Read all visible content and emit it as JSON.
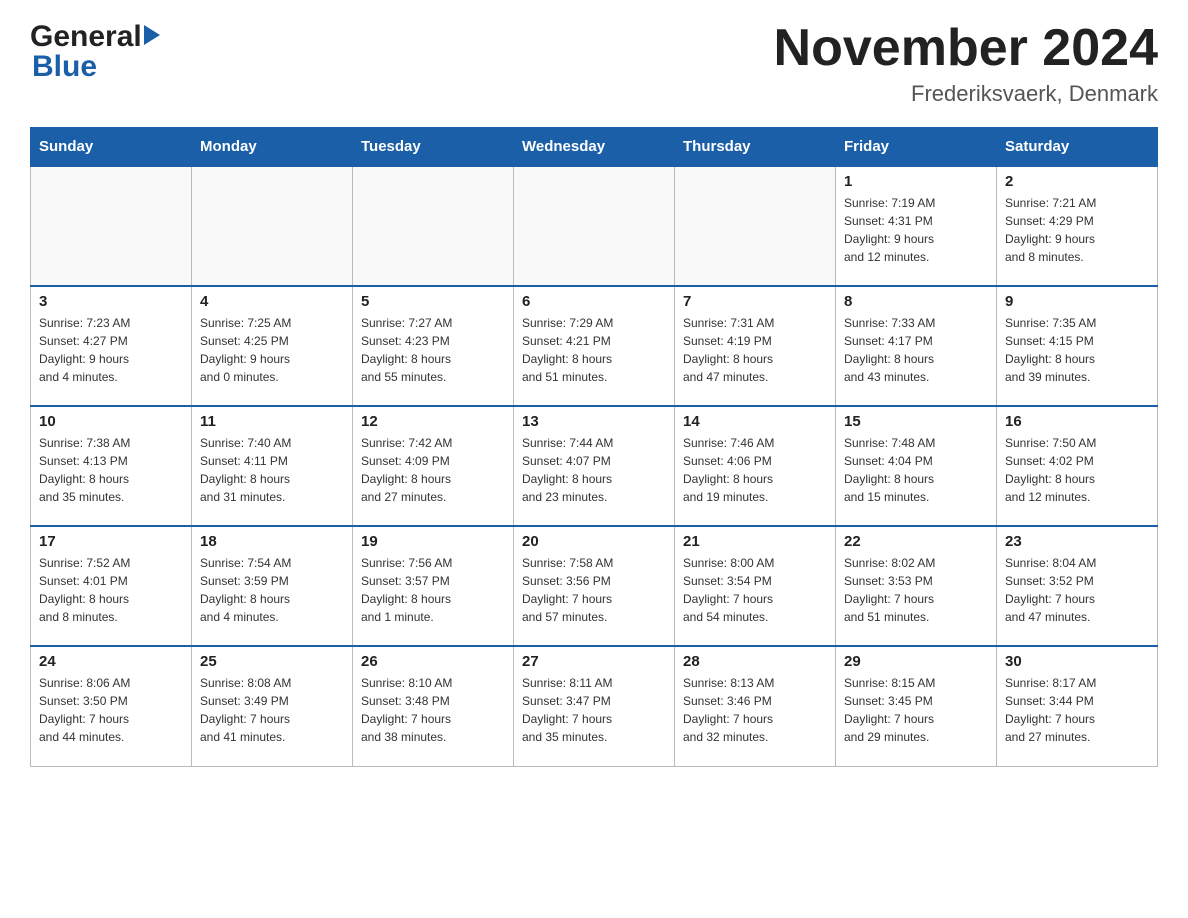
{
  "header": {
    "logo_general": "General",
    "logo_blue": "Blue",
    "month_title": "November 2024",
    "location": "Frederiksvaerk, Denmark"
  },
  "days_of_week": [
    "Sunday",
    "Monday",
    "Tuesday",
    "Wednesday",
    "Thursday",
    "Friday",
    "Saturday"
  ],
  "weeks": [
    [
      {
        "day": "",
        "info": ""
      },
      {
        "day": "",
        "info": ""
      },
      {
        "day": "",
        "info": ""
      },
      {
        "day": "",
        "info": ""
      },
      {
        "day": "",
        "info": ""
      },
      {
        "day": "1",
        "info": "Sunrise: 7:19 AM\nSunset: 4:31 PM\nDaylight: 9 hours\nand 12 minutes."
      },
      {
        "day": "2",
        "info": "Sunrise: 7:21 AM\nSunset: 4:29 PM\nDaylight: 9 hours\nand 8 minutes."
      }
    ],
    [
      {
        "day": "3",
        "info": "Sunrise: 7:23 AM\nSunset: 4:27 PM\nDaylight: 9 hours\nand 4 minutes."
      },
      {
        "day": "4",
        "info": "Sunrise: 7:25 AM\nSunset: 4:25 PM\nDaylight: 9 hours\nand 0 minutes."
      },
      {
        "day": "5",
        "info": "Sunrise: 7:27 AM\nSunset: 4:23 PM\nDaylight: 8 hours\nand 55 minutes."
      },
      {
        "day": "6",
        "info": "Sunrise: 7:29 AM\nSunset: 4:21 PM\nDaylight: 8 hours\nand 51 minutes."
      },
      {
        "day": "7",
        "info": "Sunrise: 7:31 AM\nSunset: 4:19 PM\nDaylight: 8 hours\nand 47 minutes."
      },
      {
        "day": "8",
        "info": "Sunrise: 7:33 AM\nSunset: 4:17 PM\nDaylight: 8 hours\nand 43 minutes."
      },
      {
        "day": "9",
        "info": "Sunrise: 7:35 AM\nSunset: 4:15 PM\nDaylight: 8 hours\nand 39 minutes."
      }
    ],
    [
      {
        "day": "10",
        "info": "Sunrise: 7:38 AM\nSunset: 4:13 PM\nDaylight: 8 hours\nand 35 minutes."
      },
      {
        "day": "11",
        "info": "Sunrise: 7:40 AM\nSunset: 4:11 PM\nDaylight: 8 hours\nand 31 minutes."
      },
      {
        "day": "12",
        "info": "Sunrise: 7:42 AM\nSunset: 4:09 PM\nDaylight: 8 hours\nand 27 minutes."
      },
      {
        "day": "13",
        "info": "Sunrise: 7:44 AM\nSunset: 4:07 PM\nDaylight: 8 hours\nand 23 minutes."
      },
      {
        "day": "14",
        "info": "Sunrise: 7:46 AM\nSunset: 4:06 PM\nDaylight: 8 hours\nand 19 minutes."
      },
      {
        "day": "15",
        "info": "Sunrise: 7:48 AM\nSunset: 4:04 PM\nDaylight: 8 hours\nand 15 minutes."
      },
      {
        "day": "16",
        "info": "Sunrise: 7:50 AM\nSunset: 4:02 PM\nDaylight: 8 hours\nand 12 minutes."
      }
    ],
    [
      {
        "day": "17",
        "info": "Sunrise: 7:52 AM\nSunset: 4:01 PM\nDaylight: 8 hours\nand 8 minutes."
      },
      {
        "day": "18",
        "info": "Sunrise: 7:54 AM\nSunset: 3:59 PM\nDaylight: 8 hours\nand 4 minutes."
      },
      {
        "day": "19",
        "info": "Sunrise: 7:56 AM\nSunset: 3:57 PM\nDaylight: 8 hours\nand 1 minute."
      },
      {
        "day": "20",
        "info": "Sunrise: 7:58 AM\nSunset: 3:56 PM\nDaylight: 7 hours\nand 57 minutes."
      },
      {
        "day": "21",
        "info": "Sunrise: 8:00 AM\nSunset: 3:54 PM\nDaylight: 7 hours\nand 54 minutes."
      },
      {
        "day": "22",
        "info": "Sunrise: 8:02 AM\nSunset: 3:53 PM\nDaylight: 7 hours\nand 51 minutes."
      },
      {
        "day": "23",
        "info": "Sunrise: 8:04 AM\nSunset: 3:52 PM\nDaylight: 7 hours\nand 47 minutes."
      }
    ],
    [
      {
        "day": "24",
        "info": "Sunrise: 8:06 AM\nSunset: 3:50 PM\nDaylight: 7 hours\nand 44 minutes."
      },
      {
        "day": "25",
        "info": "Sunrise: 8:08 AM\nSunset: 3:49 PM\nDaylight: 7 hours\nand 41 minutes."
      },
      {
        "day": "26",
        "info": "Sunrise: 8:10 AM\nSunset: 3:48 PM\nDaylight: 7 hours\nand 38 minutes."
      },
      {
        "day": "27",
        "info": "Sunrise: 8:11 AM\nSunset: 3:47 PM\nDaylight: 7 hours\nand 35 minutes."
      },
      {
        "day": "28",
        "info": "Sunrise: 8:13 AM\nSunset: 3:46 PM\nDaylight: 7 hours\nand 32 minutes."
      },
      {
        "day": "29",
        "info": "Sunrise: 8:15 AM\nSunset: 3:45 PM\nDaylight: 7 hours\nand 29 minutes."
      },
      {
        "day": "30",
        "info": "Sunrise: 8:17 AM\nSunset: 3:44 PM\nDaylight: 7 hours\nand 27 minutes."
      }
    ]
  ]
}
